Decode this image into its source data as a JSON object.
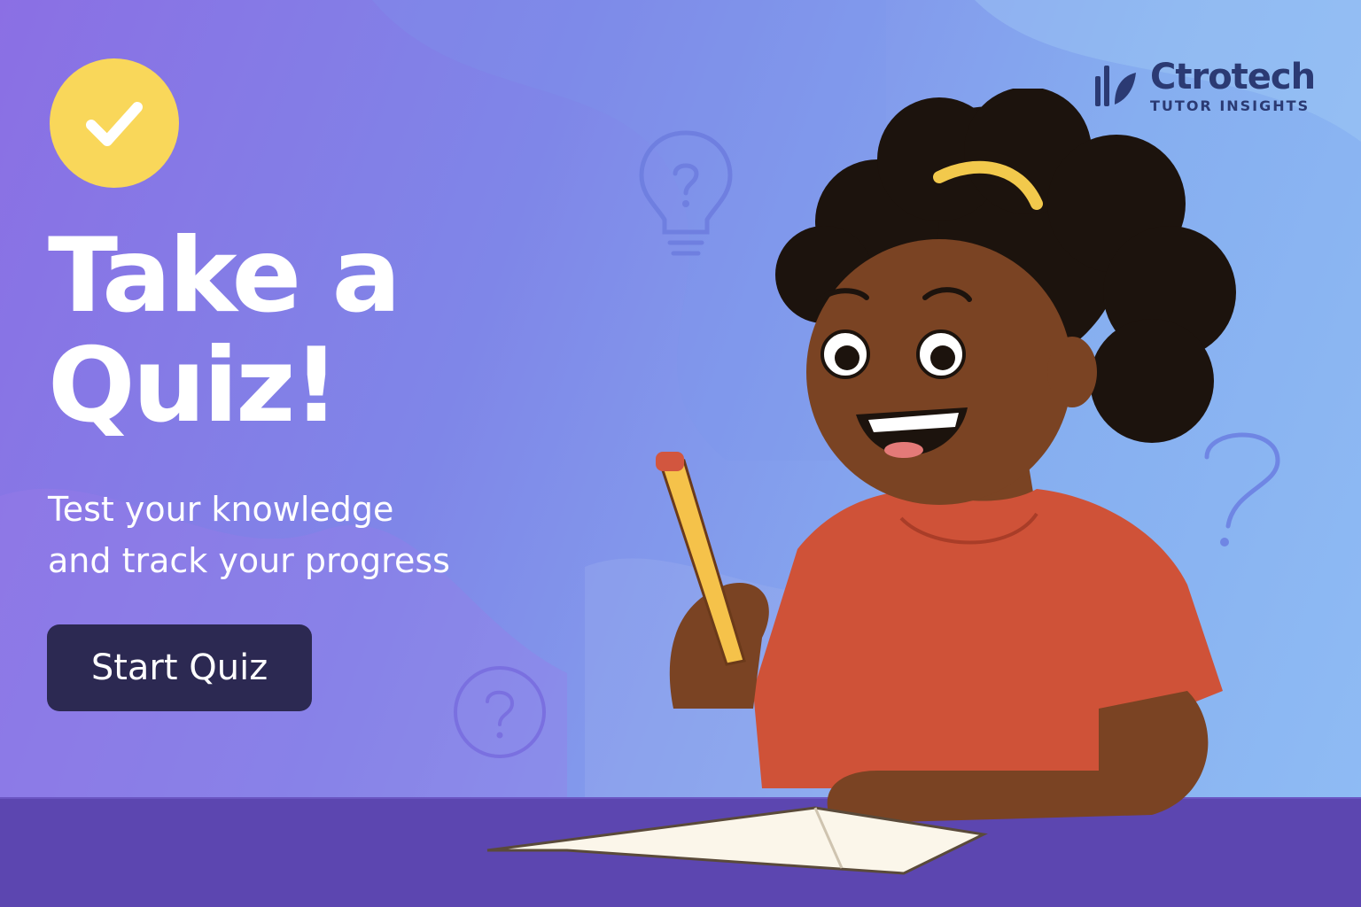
{
  "hero": {
    "headline_line1": "Take a",
    "headline_line2": "Quiz!",
    "subtitle_line1": "Test your knowledge",
    "subtitle_line2": "and track your progress",
    "cta_label": "Start Quiz"
  },
  "brand": {
    "name": "Ctrotech",
    "tagline": "TUTOR INSIGHTS"
  },
  "icons": {
    "badge": "checkmark-icon",
    "decor": [
      "lightbulb-question-icon",
      "question-circle-icon",
      "question-mark-icon"
    ]
  },
  "colors": {
    "badge": "#f9d75a",
    "button": "#2c2952",
    "brand": "#2b3a73",
    "desk": "#5c46b0",
    "shirt": "#cf5238"
  }
}
